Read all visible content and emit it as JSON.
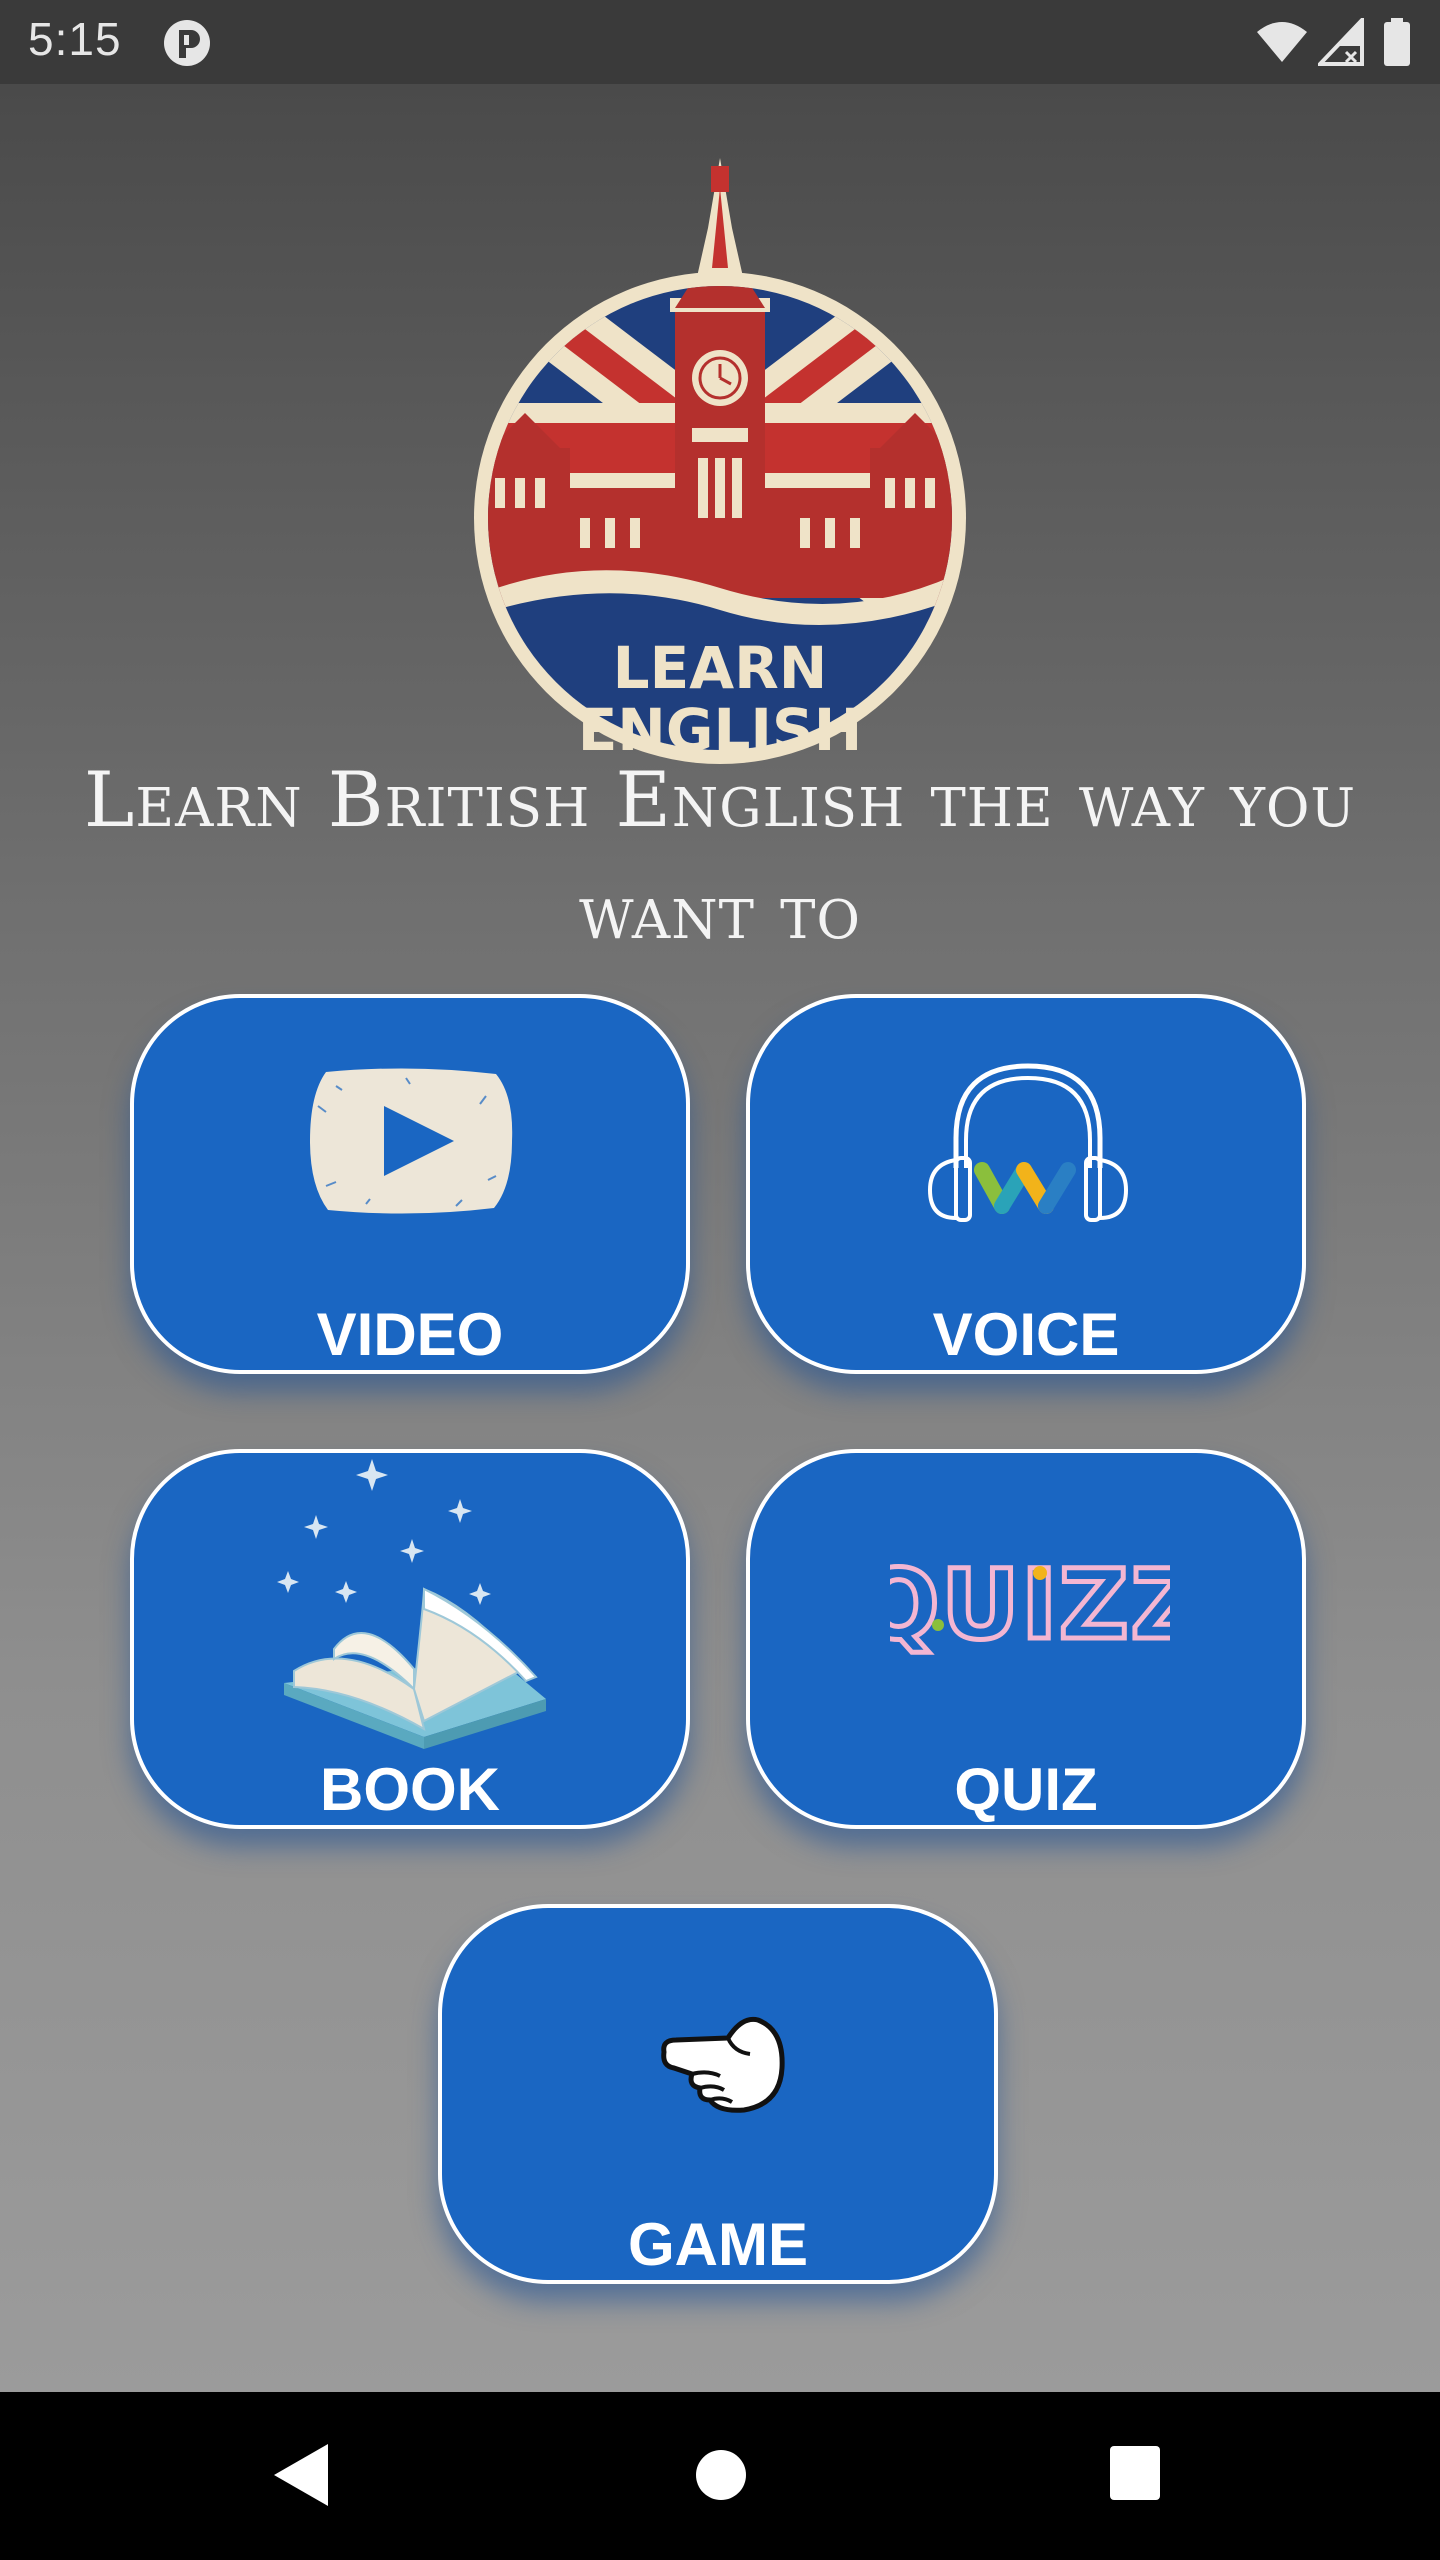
{
  "status_bar": {
    "time": "5:15",
    "icons": [
      "app-notification-icon",
      "wifi-icon",
      "cellular-signal-icon",
      "battery-icon"
    ]
  },
  "logo": {
    "text_line1": "LEARN",
    "text_line2": "ENGLISH",
    "icon": "big-ben-union-jack-logo"
  },
  "headline": "Learn British English the way you want to",
  "menu": {
    "video": {
      "label": "VIDEO",
      "icon": "video-play-icon"
    },
    "voice": {
      "label": "VOICE",
      "icon": "headphones-icon"
    },
    "book": {
      "label": "BOOK",
      "icon": "open-book-icon"
    },
    "quiz": {
      "label": "QUIZ",
      "icon": "quizz-text-icon",
      "icon_text": "QUIZZ"
    },
    "game": {
      "label": "GAME",
      "icon": "pointing-hand-icon"
    }
  },
  "colors": {
    "tile_blue": "#1a66c2",
    "status_bar": "#3a3a3a",
    "nav_bar": "#000000"
  },
  "nav_bar": {
    "icons": [
      "back-icon",
      "home-icon",
      "recents-icon"
    ]
  }
}
